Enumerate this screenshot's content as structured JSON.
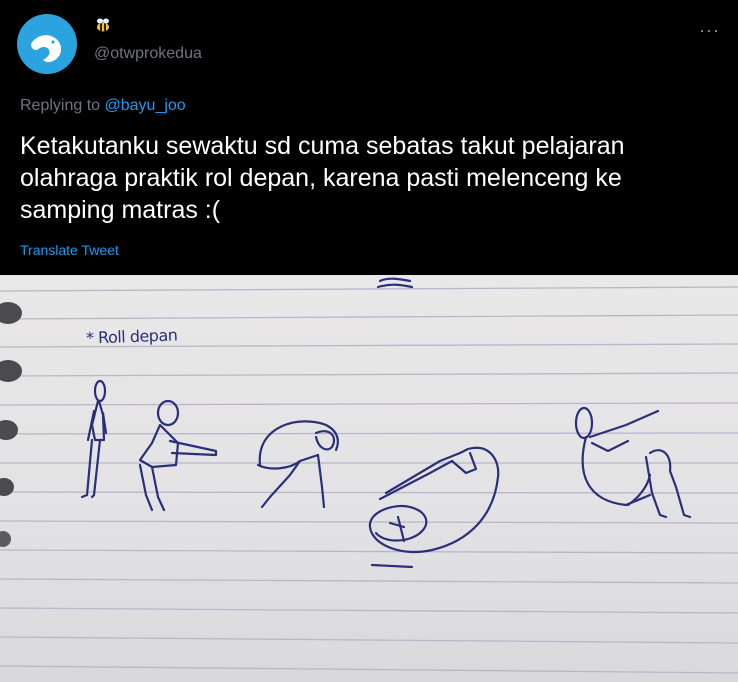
{
  "tweet": {
    "handle": "@otwprokedua",
    "more_label": "···",
    "reply_prefix": "Replying to ",
    "reply_mention": "@bayu_joo",
    "text": "Ketakutanku sewaktu sd cuma sebatas takut pelajaran olahraga praktik rol depan, karena pasti melenceng ke samping matras :(",
    "translate_label": "Translate Tweet"
  },
  "photo": {
    "note_heading": "* Roll depan",
    "ink_color": "#2a2f7a",
    "paper_line_color": "#b9b6c9"
  }
}
